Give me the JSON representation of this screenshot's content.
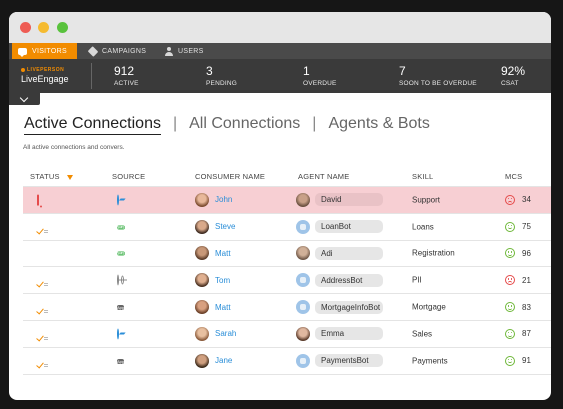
{
  "nav": {
    "tabs": [
      {
        "label": "VISITORS",
        "icon": "chat-icon",
        "active": true
      },
      {
        "label": "CAMPAIGNS",
        "icon": "tag-icon",
        "active": false
      },
      {
        "label": "USERS",
        "icon": "user-icon",
        "active": false
      }
    ]
  },
  "brand": {
    "top": "LIVEPERSON",
    "name": "LiveEngage"
  },
  "stats": [
    {
      "value": "912",
      "label": "ACTIVE"
    },
    {
      "value": "3",
      "label": "PENDING"
    },
    {
      "value": "1",
      "label": "OVERDUE"
    },
    {
      "value": "7",
      "label": "SOON TO BE OVERDUE"
    },
    {
      "value": "92%",
      "label": "CSAT"
    }
  ],
  "tabs": {
    "active": "Active Connections",
    "all": "All Connections",
    "bots": "Agents & Bots",
    "separator": "|"
  },
  "subtitle": "All active connections and convers.",
  "table": {
    "headers": {
      "status": "STATUS",
      "source": "SOURCE",
      "consumer": "CONSUMER NAME",
      "agent": "AGENT NAME",
      "skill": "SKILL",
      "mcs": "MCS"
    },
    "rows": [
      {
        "status": "bell-icon",
        "source": "messenger-icon",
        "consumer": "John",
        "agent": "David",
        "agent_bot": false,
        "skill": "Support",
        "mcs": "34",
        "mcs_mood": "bad",
        "alert": true
      },
      {
        "status": "check-icon",
        "source": "sms-icon",
        "consumer": "Steve",
        "agent": "LoanBot",
        "agent_bot": true,
        "skill": "Loans",
        "mcs": "75",
        "mcs_mood": "good",
        "alert": false
      },
      {
        "status": "timer-icon",
        "source": "sms-icon",
        "consumer": "Matt",
        "agent": "Adi",
        "agent_bot": false,
        "skill": "Registration",
        "mcs": "96",
        "mcs_mood": "good",
        "alert": false
      },
      {
        "status": "check-icon",
        "source": "web-icon",
        "consumer": "Tom",
        "agent": "AddressBot",
        "agent_bot": true,
        "skill": "PII",
        "mcs": "21",
        "mcs_mood": "bad",
        "alert": false
      },
      {
        "status": "check-icon",
        "source": "app-icon",
        "consumer": "Matt",
        "agent": "MortgageInfoBot",
        "agent_bot": true,
        "skill": "Mortgage",
        "mcs": "83",
        "mcs_mood": "good",
        "alert": false
      },
      {
        "status": "check-icon",
        "source": "messenger-icon",
        "consumer": "Sarah",
        "agent": "Emma",
        "agent_bot": false,
        "skill": "Sales",
        "mcs": "87",
        "mcs_mood": "good",
        "alert": false
      },
      {
        "status": "check-icon",
        "source": "app-icon",
        "consumer": "Jane",
        "agent": "PaymentsBot",
        "agent_bot": true,
        "skill": "Payments",
        "mcs": "91",
        "mcs_mood": "good",
        "alert": false
      }
    ],
    "source_labels": {
      "sms": "SMS",
      "app": "App"
    }
  },
  "colors": {
    "accent": "#f28c00",
    "alert_row": "#f7cfd3",
    "link": "#2a8ed8",
    "good": "#6fb83a",
    "bad": "#e54b4b"
  }
}
